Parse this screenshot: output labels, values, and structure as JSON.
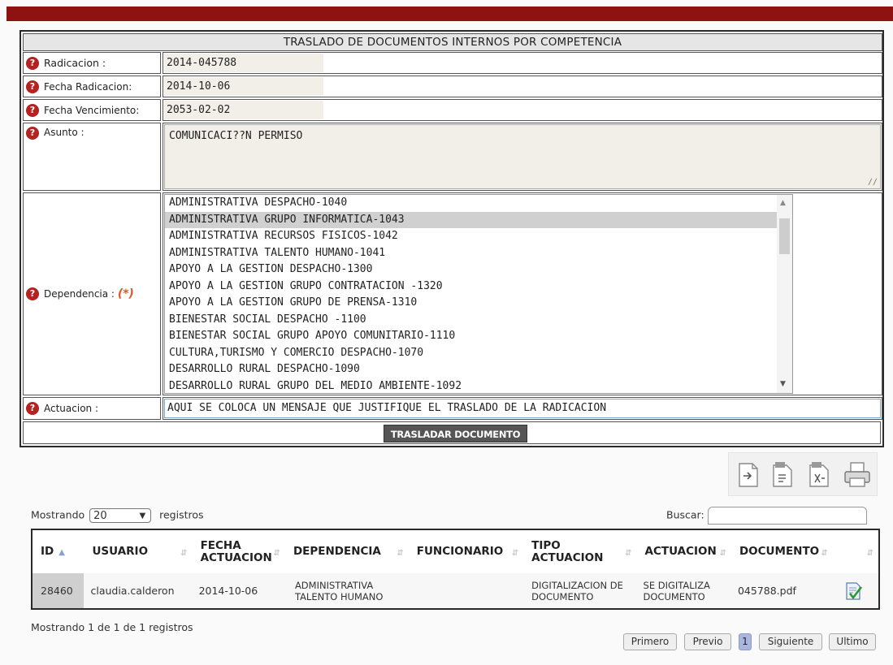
{
  "form": {
    "title": "TRASLADO DE DOCUMENTOS INTERNOS POR COMPETENCIA",
    "radicacion": {
      "label": "Radicacion :",
      "value": "2014-045788"
    },
    "fecha_radicacion": {
      "label": "Fecha Radicacion:",
      "value": "2014-10-06"
    },
    "fecha_vencimiento": {
      "label": "Fecha Vencimiento:",
      "value": "2053-02-02"
    },
    "asunto": {
      "label": "Asunto :",
      "value": "COMUNICACI??N PERMISO"
    },
    "dependencia": {
      "label": "Dependencia :",
      "required_mark": "(*)",
      "options": [
        "ADMINISTRATIVA DESPACHO-1040",
        "ADMINISTRATIVA GRUPO INFORMATICA-1043",
        "ADMINISTRATIVA RECURSOS FISICOS-1042",
        "ADMINISTRATIVA TALENTO HUMANO-1041",
        "APOYO A LA GESTION DESPACHO-1300",
        "APOYO A LA GESTION GRUPO CONTRATACION -1320",
        "APOYO A LA GESTION GRUPO DE PRENSA-1310",
        "BIENESTAR SOCIAL DESPACHO -1100",
        "BIENESTAR SOCIAL GRUPO APOYO COMUNITARIO-1110",
        "CULTURA,TURISMO Y COMERCIO DESPACHO-1070",
        "DESARROLLO RURAL DESPACHO-1090",
        "DESARROLLO RURAL GRUPO DEL MEDIO AMBIENTE-1092"
      ],
      "selected": "ADMINISTRATIVA GRUPO INFORMATICA-1043"
    },
    "actuacion": {
      "label": "Actuacion :",
      "value": "AQUI SE COLOCA UN MENSAJE QUE JUSTIFIQUE EL TRASLADO DE LA RADICACION"
    },
    "submit_label": "TRASLADAR DOCUMENTO"
  },
  "toolbar": {
    "icons": [
      "export-document-icon",
      "csv-file-icon",
      "excel-file-icon",
      "printer-icon"
    ]
  },
  "table_controls": {
    "length_prefix": "Mostrando",
    "length_value": "20",
    "length_suffix": "registros",
    "search_label": "Buscar:"
  },
  "table": {
    "headers": [
      "ID",
      "USUARIO",
      "FECHA ACTUACION",
      "DEPENDENCIA",
      "FUNCIONARIO",
      "TIPO ACTUACION",
      "ACTUACION",
      "DOCUMENTO",
      ""
    ],
    "rows": [
      {
        "id": "28460",
        "usuario": "claudia.calderon",
        "fecha": "2014-10-06",
        "dependencia": "ADMINISTRATIVA TALENTO HUMANO",
        "funcionario": "",
        "tipo": "DIGITALIZACION DE DOCUMENTO",
        "actuacion": "SE DIGITALIZA DOCUMENTO",
        "documento": "045788.pdf",
        "action_icon": "approve-document-icon"
      }
    ],
    "info": "Mostrando 1 de 1 de 1 registros"
  },
  "pagination": {
    "first": "Primero",
    "prev": "Previo",
    "current": "1",
    "next": "Siguiente",
    "last": "Ultimo"
  },
  "colors": {
    "header_bar": "#8e1212",
    "required_mark": "#e0542b",
    "help_icon": "#b52222",
    "button_dark": "#555555",
    "current_page": "#a9b6dd"
  }
}
